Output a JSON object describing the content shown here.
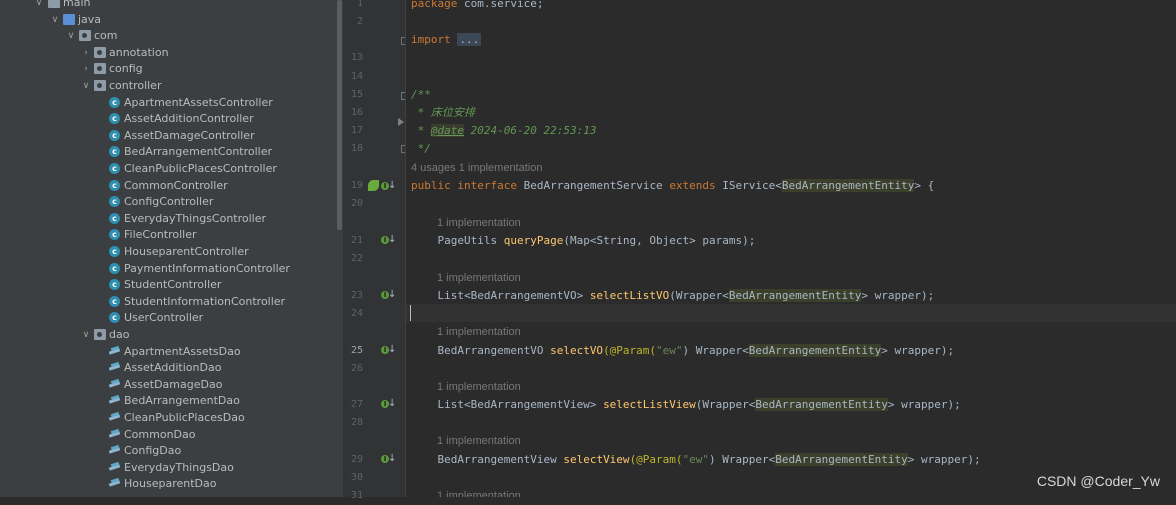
{
  "tree": [
    {
      "label": "main",
      "depth": 0,
      "icon": "folder-icon",
      "expanded": true
    },
    {
      "label": "java",
      "depth": 1,
      "icon": "source-folder-icon",
      "expanded": true
    },
    {
      "label": "com",
      "depth": 2,
      "icon": "package-icon",
      "expanded": true
    },
    {
      "label": "annotation",
      "depth": 3,
      "icon": "package-icon",
      "expanded": false
    },
    {
      "label": "config",
      "depth": 3,
      "icon": "package-icon",
      "expanded": false
    },
    {
      "label": "controller",
      "depth": 3,
      "icon": "package-icon",
      "expanded": true
    },
    {
      "label": "ApartmentAssetsController",
      "depth": 4,
      "icon": "class-icon"
    },
    {
      "label": "AssetAdditionController",
      "depth": 4,
      "icon": "class-icon"
    },
    {
      "label": "AssetDamageController",
      "depth": 4,
      "icon": "class-icon"
    },
    {
      "label": "BedArrangementController",
      "depth": 4,
      "icon": "class-icon"
    },
    {
      "label": "CleanPublicPlacesController",
      "depth": 4,
      "icon": "class-icon"
    },
    {
      "label": "CommonController",
      "depth": 4,
      "icon": "class-icon"
    },
    {
      "label": "ConfigController",
      "depth": 4,
      "icon": "class-icon"
    },
    {
      "label": "EverydayThingsController",
      "depth": 4,
      "icon": "class-icon"
    },
    {
      "label": "FileController",
      "depth": 4,
      "icon": "class-icon"
    },
    {
      "label": "HouseparentController",
      "depth": 4,
      "icon": "class-icon"
    },
    {
      "label": "PaymentInformationController",
      "depth": 4,
      "icon": "class-icon"
    },
    {
      "label": "StudentController",
      "depth": 4,
      "icon": "class-icon"
    },
    {
      "label": "StudentInformationController",
      "depth": 4,
      "icon": "class-icon"
    },
    {
      "label": "UserController",
      "depth": 4,
      "icon": "class-icon"
    },
    {
      "label": "dao",
      "depth": 3,
      "icon": "package-icon",
      "expanded": true
    },
    {
      "label": "ApartmentAssetsDao",
      "depth": 4,
      "icon": "interface-icon"
    },
    {
      "label": "AssetAdditionDao",
      "depth": 4,
      "icon": "interface-icon"
    },
    {
      "label": "AssetDamageDao",
      "depth": 4,
      "icon": "interface-icon"
    },
    {
      "label": "BedArrangementDao",
      "depth": 4,
      "icon": "interface-icon"
    },
    {
      "label": "CleanPublicPlacesDao",
      "depth": 4,
      "icon": "interface-icon"
    },
    {
      "label": "CommonDao",
      "depth": 4,
      "icon": "interface-icon"
    },
    {
      "label": "ConfigDao",
      "depth": 4,
      "icon": "interface-icon"
    },
    {
      "label": "EverydayThingsDao",
      "depth": 4,
      "icon": "interface-icon"
    },
    {
      "label": "HouseparentDao",
      "depth": 4,
      "icon": "interface-icon"
    }
  ],
  "line_numbers": [
    "1",
    "2",
    "13",
    "14",
    "15",
    "16",
    "17",
    "18",
    "19",
    "20",
    "21",
    "22",
    "23",
    "24",
    "25",
    "26",
    "27",
    "28",
    "29",
    "30",
    "31"
  ],
  "current_line": "25",
  "code": {
    "l1_kw": "package",
    "l1_rest": " com.service;",
    "l2_kw": "import",
    "l2_fold": "...",
    "l16": "/**",
    "l17": " * 床位安排",
    "l18_star": " * ",
    "l18_tag": "@date",
    "l18_rest": " 2024-06-20 22:53:13",
    "l19": " */",
    "hint_interface": "4 usages   1 implementation",
    "l20_kw1": "public",
    "l20_kw2": "interface",
    "l20_name": "BedArrangementService",
    "l20_kw3": "extends",
    "l20_super": "IService<",
    "l20_generic": "BedArrangementEntity",
    "l20_end": "> {",
    "hint_1": "1 implementation",
    "l22_type": "    PageUtils ",
    "l22_fn": "queryPage",
    "l22_rest": "(Map<String, Object> params);",
    "hint_2": "1 implementation",
    "l24_type": "    List<BedArrangementVO> ",
    "l24_fn": "selectListVO",
    "l24_pre": "(Wrapper<",
    "l24_generic": "BedArrangementEntity",
    "l24_end": "> wrapper);",
    "hint_3": "1 implementation",
    "l26_type": "    BedArrangementVO ",
    "l26_fn": "selectVO",
    "l26_ann": "(@Param(",
    "l26_str": "\"ew\"",
    "l26_mid": ") Wrapper<",
    "l26_generic": "BedArrangementEntity",
    "l26_end": "> wrapper);",
    "hint_4": "1 implementation",
    "l28_type": "    List<BedArrangementView> ",
    "l28_fn": "selectListView",
    "l28_pre": "(Wrapper<",
    "l28_generic": "BedArrangementEntity",
    "l28_end": "> wrapper);",
    "hint_5": "1 implementation",
    "l30_type": "    BedArrangementView ",
    "l30_fn": "selectView",
    "l30_ann": "(@Param(",
    "l30_str": "\"ew\"",
    "l30_mid": ") Wrapper<",
    "l30_generic": "BedArrangementEntity",
    "l30_end": "> wrapper);",
    "hint_6": "1 implementation"
  },
  "watermark": "CSDN @Coder_Yw",
  "colors": {
    "keyword": "#cc7832",
    "comment": "#629755",
    "method": "#ffc66d",
    "string": "#6a8759",
    "annotation": "#bbb529",
    "text": "#a9b7c6"
  }
}
